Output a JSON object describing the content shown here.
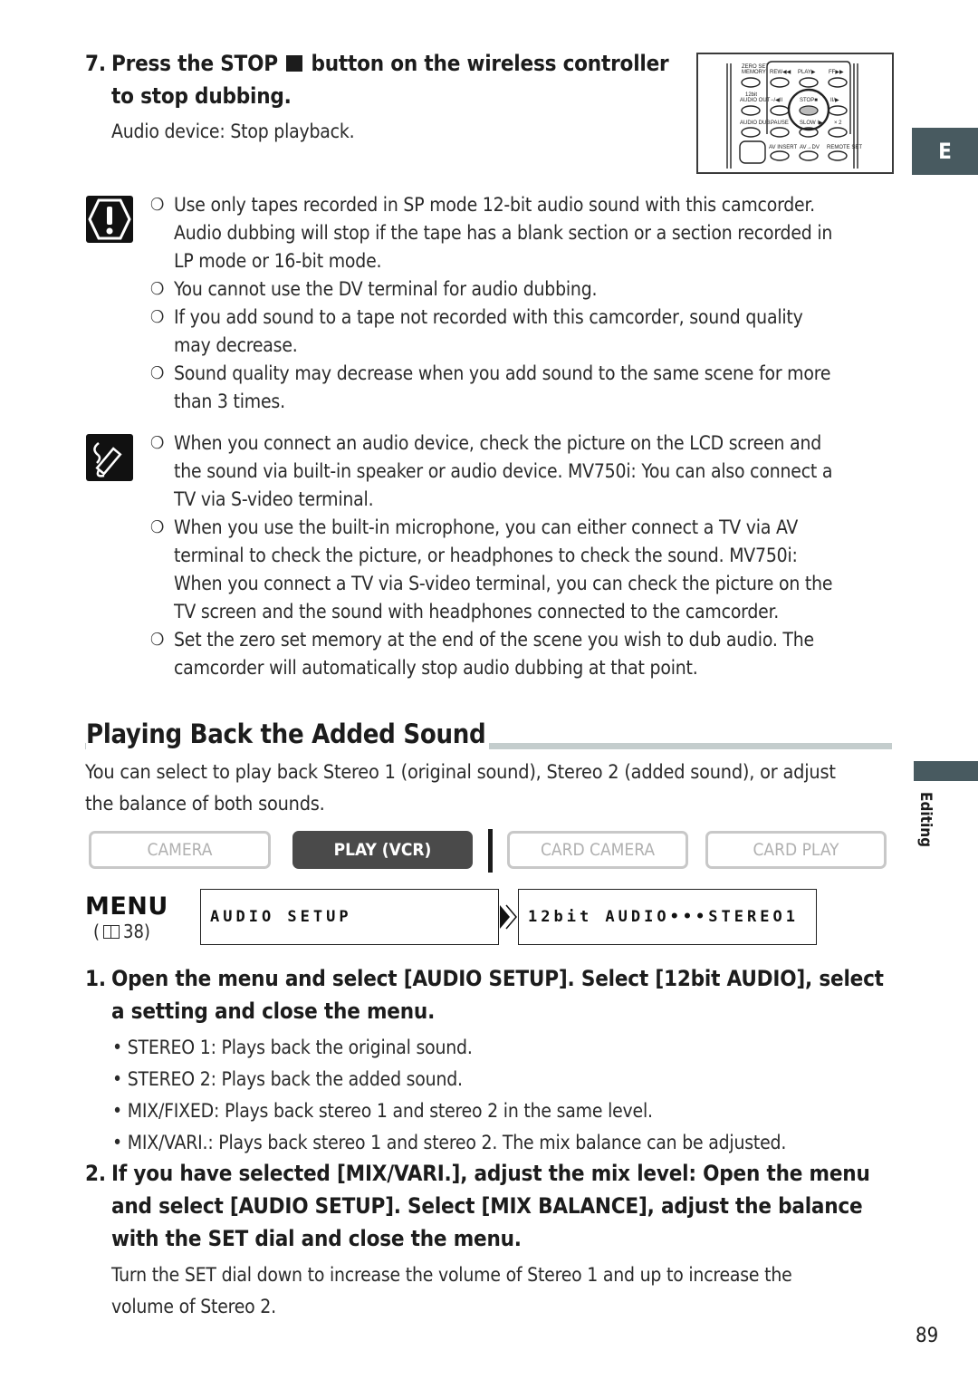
{
  "side_tabs": {
    "language": "E",
    "chapter": "Editing"
  },
  "step7": {
    "number": "7.",
    "heading_before_icon": "Press the STOP",
    "heading_after_icon": "button on the wireless controller",
    "heading_line2": "to stop dubbing.",
    "subtext": "Audio device: Stop playback.",
    "stop_icon": "stop-square-icon"
  },
  "remote_illustration": {
    "labels": [
      "ZERO SET MEMORY",
      "REW",
      "PLAY",
      "FF",
      "12bit AUDIO OUT",
      "STOP",
      "AUDIO DUB.",
      "PAUSE",
      "SLOW",
      "× 2",
      "AV INSERT",
      "AV→DV",
      "REMOTE SET"
    ],
    "highlighted_button": "STOP"
  },
  "caution_notes": {
    "icon": "caution-icon",
    "items": [
      [
        "Use only tapes recorded in SP mode 12-bit audio sound with this camcorder.",
        "Audio dubbing will stop if the tape has a blank section or a section recorded in",
        "LP mode or 16-bit mode."
      ],
      [
        "You cannot use the DV terminal for audio dubbing."
      ],
      [
        "If you add sound to a tape not recorded with this camcorder, sound quality",
        "may decrease."
      ],
      [
        "Sound quality may decrease when you add sound to the same scene for more",
        "than 3 times."
      ]
    ]
  },
  "tip_notes": {
    "icon": "pencil-note-icon",
    "items": [
      [
        "When you connect an audio device, check the picture on the LCD screen and",
        "the sound via built-in speaker or audio device. MV750i: You can also connect a",
        "TV via S-video terminal."
      ],
      [
        "When you use the built-in microphone, you can either connect a TV via AV",
        "terminal to check the picture, or headphones to check the sound. MV750i:",
        "When you connect a TV via S-video terminal, you can check the picture on the",
        "TV screen and the sound with headphones connected to the camcorder."
      ],
      [
        "Set the zero set memory at the end of the scene you wish to dub audio. The",
        "camcorder will automatically stop audio dubbing at that point."
      ]
    ]
  },
  "section": {
    "title": "Playing Back the Added Sound",
    "intro_line1": "You can select to play back Stereo 1 (original sound), Stereo 2 (added sound), or adjust",
    "intro_line2": "the balance of both sounds."
  },
  "modes": [
    {
      "label": "CAMERA",
      "active": false
    },
    {
      "label": "PLAY (VCR)",
      "active": true
    },
    {
      "label": "CARD CAMERA",
      "active": false
    },
    {
      "label": "CARD PLAY",
      "active": false
    }
  ],
  "menu": {
    "label": "MENU",
    "ref_page": "38",
    "submenu": "AUDIO SETUP",
    "setting": "12bit AUDIO•••STEREO1"
  },
  "step1": {
    "number": "1.",
    "line1": "Open the menu and select [AUDIO SETUP]. Select [12bit AUDIO], select",
    "line2": "a setting and close the menu.",
    "bullets": [
      "STEREO 1: Plays back the original sound.",
      "STEREO 2: Plays back the added sound.",
      "MIX/FIXED: Plays back stereo 1 and stereo 2 in the same level.",
      "MIX/VARI.: Plays back stereo 1 and stereo 2. The mix balance can be adjusted."
    ]
  },
  "step2": {
    "number": "2.",
    "line1": "If you have selected [MIX/VARI.], adjust the mix level: Open the menu",
    "line2": "and select [AUDIO SETUP]. Select [MIX BALANCE], adjust the balance",
    "line3": "with the SET dial and close the menu.",
    "sub_line1": "Turn the SET dial down to increase the volume of Stereo 1 and up to increase the",
    "sub_line2": "volume of Stereo 2."
  },
  "page_number": "89"
}
